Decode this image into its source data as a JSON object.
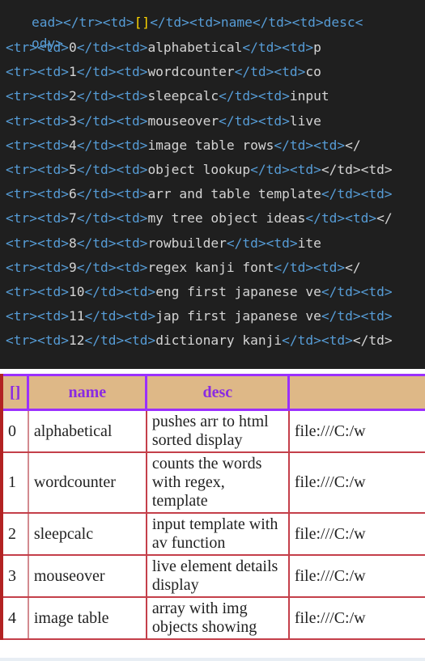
{
  "editor": {
    "top_partial_lines": [
      {
        "prefix": "ead></tr><td>",
        "bracket": "[]",
        "suffix": "</td><td>name</td><td>desc<"
      },
      {
        "text": "ody>"
      }
    ],
    "rows": [
      {
        "idx": "0",
        "name": "alphabetical",
        "tail": "p"
      },
      {
        "idx": "1",
        "name": "wordcounter",
        "tail": "co"
      },
      {
        "idx": "2",
        "name": "sleepcalc",
        "tail": "input"
      },
      {
        "idx": "3",
        "name": "mouseover",
        "tail": "live"
      },
      {
        "idx": "4",
        "name": "image table rows",
        "tail": "</"
      },
      {
        "idx": "5",
        "name": "object lookup",
        "tail": "</td><td>"
      },
      {
        "idx": "6",
        "name": "arr and table template",
        "tail": ""
      },
      {
        "idx": "7",
        "name": "my tree object ideas",
        "tail": "</"
      },
      {
        "idx": "8",
        "name": "rowbuilder",
        "tail": "ite"
      },
      {
        "idx": "9",
        "name": "regex kanji font",
        "tail": "</"
      },
      {
        "idx": "10",
        "name": "eng first japanese ve",
        "tail": ""
      },
      {
        "idx": "11",
        "name": "jap first japanese ve",
        "tail": ""
      },
      {
        "idx": "12",
        "name": "dictionary kanji",
        "tail": "</td>"
      }
    ]
  },
  "table": {
    "headers": [
      "[]",
      "name",
      "desc",
      ""
    ],
    "rows": [
      {
        "idx": "0",
        "name": "alphabetical",
        "desc": "pushes arr to html sorted display",
        "link": "file:///C:/w"
      },
      {
        "idx": "1",
        "name": "wordcounter",
        "desc": "counts the words with regex, template",
        "link": "file:///C:/w"
      },
      {
        "idx": "2",
        "name": "sleepcalc",
        "desc": "input template with av function",
        "link": "file:///C:/w"
      },
      {
        "idx": "3",
        "name": "mouseover",
        "desc": "live element details display",
        "link": "file:///C:/w"
      },
      {
        "idx": "4",
        "name": "image table",
        "desc": "array with img objects showing",
        "link": "file:///C:/w"
      }
    ]
  },
  "colors": {
    "editor_bg": "#1f1f1f",
    "tag": "#569cd6",
    "text": "#d4d4d4",
    "header_bg": "#deb887",
    "header_text": "#8a2be2",
    "header_border": "#9b30ff",
    "cell_border": "#c43f4a"
  }
}
